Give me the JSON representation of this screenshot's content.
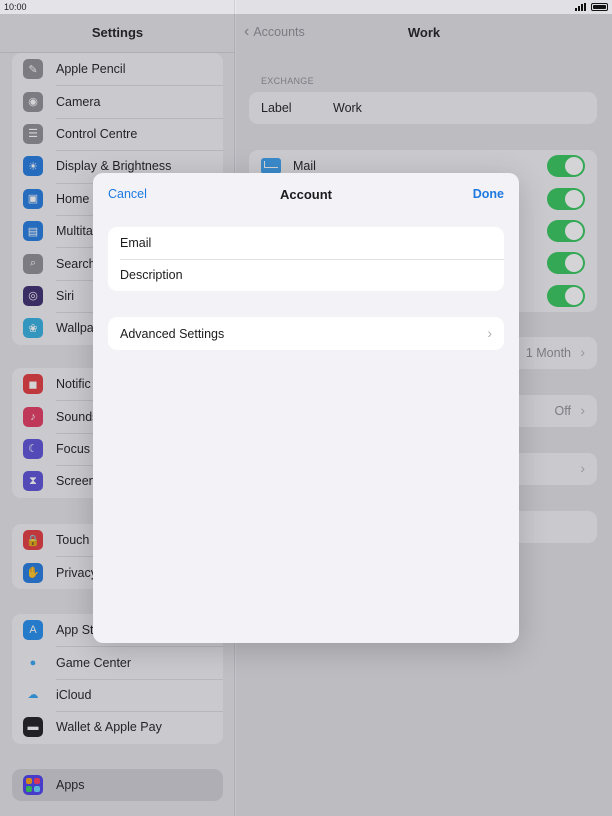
{
  "status": {
    "time": "10:00"
  },
  "sidebar": {
    "title": "Settings",
    "group1": [
      {
        "label": "Apple Pencil",
        "icon": "pencil-icon",
        "color": "#8e8e93",
        "glyph": "✎"
      },
      {
        "label": "Camera",
        "icon": "camera-icon",
        "color": "#8e8e93",
        "glyph": "◉"
      },
      {
        "label": "Control Centre",
        "icon": "switches-icon",
        "color": "#8e8e93",
        "glyph": "☰"
      },
      {
        "label": "Display & Brightness",
        "icon": "sun-icon",
        "color": "#1f7ae0",
        "glyph": "☀"
      },
      {
        "label": "Home",
        "icon": "home-screen-icon",
        "color": "#1f7ae0",
        "glyph": "▣"
      },
      {
        "label": "Multita",
        "icon": "multitasking-icon",
        "color": "#1f7ae0",
        "glyph": "▤"
      },
      {
        "label": "Search",
        "icon": "search-icon",
        "color": "#8e8e93",
        "glyph": "⌕"
      },
      {
        "label": "Siri",
        "icon": "siri-icon",
        "color": "#3a2a6e",
        "glyph": "◎"
      },
      {
        "label": "Wallpa",
        "icon": "wallpaper-icon",
        "color": "#30b0e0",
        "glyph": "❀"
      }
    ],
    "group2": [
      {
        "label": "Notific",
        "icon": "notifications-icon",
        "color": "#e5383b",
        "glyph": "◼"
      },
      {
        "label": "Sounds",
        "icon": "speaker-icon",
        "color": "#e5385f",
        "glyph": "♪"
      },
      {
        "label": "Focus",
        "icon": "moon-icon",
        "color": "#5a4fd8",
        "glyph": "☾"
      },
      {
        "label": "Screen",
        "icon": "hourglass-icon",
        "color": "#5a4fd8",
        "glyph": "⧗"
      }
    ],
    "group3": [
      {
        "label": "Touch",
        "icon": "lock-icon",
        "color": "#e5383b",
        "glyph": "🔒"
      },
      {
        "label": "Privacy",
        "icon": "hand-icon",
        "color": "#1f7ae0",
        "glyph": "✋"
      }
    ],
    "group4": [
      {
        "label": "App St",
        "icon": "app-store-icon",
        "color": "#1f8cf0",
        "glyph": "A"
      },
      {
        "label": "Game Center",
        "icon": "game-center-icon",
        "color": "#f2f2f5",
        "glyph": "●"
      },
      {
        "label": "iCloud",
        "icon": "cloud-icon",
        "color": "#f2f2f5",
        "glyph": "☁"
      },
      {
        "label": "Wallet & Apple Pay",
        "icon": "wallet-icon",
        "color": "#1c1c1e",
        "glyph": "▬"
      }
    ],
    "apps_label": "Apps"
  },
  "detail": {
    "back_label": "Accounts",
    "title": "Work",
    "section_header": "EXCHANGE",
    "label_key": "Label",
    "label_value": "Work",
    "toggles": [
      {
        "label": "Mail",
        "on": true
      },
      {
        "label": "",
        "on": true
      },
      {
        "label": "",
        "on": true
      },
      {
        "label": "",
        "on": true
      },
      {
        "label": "",
        "on": true
      }
    ],
    "mail_days_value": "1 Month",
    "auto_reply_value": "Off"
  },
  "sheet": {
    "cancel_label": "Cancel",
    "title": "Account",
    "done_label": "Done",
    "email_label": "Email",
    "email_value": "",
    "description_label": "Description",
    "description_value": "",
    "advanced_label": "Advanced Settings"
  }
}
